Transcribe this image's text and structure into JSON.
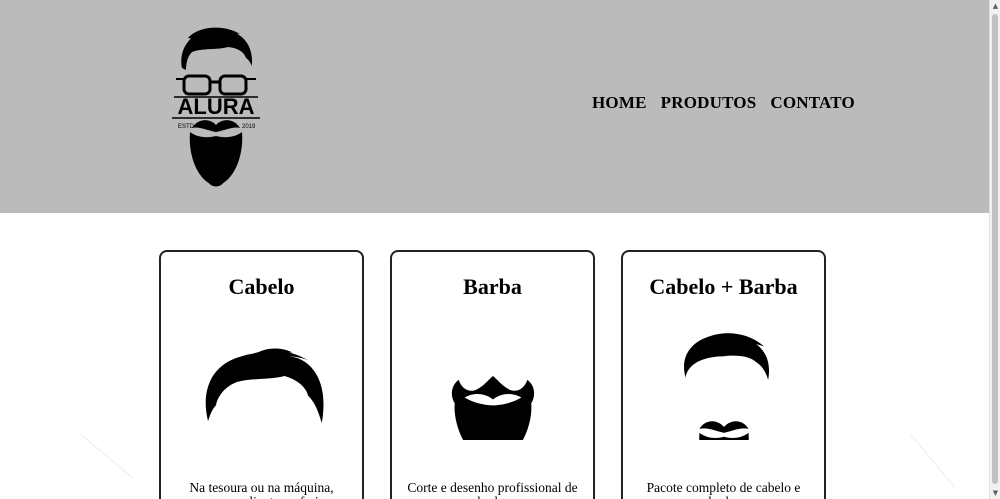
{
  "logo": {
    "brand": "ALURA",
    "left_text": "ESTD",
    "right_text": "2019"
  },
  "nav": {
    "items": [
      {
        "label": "HOME"
      },
      {
        "label": "PRODUTOS"
      },
      {
        "label": "CONTATO"
      }
    ]
  },
  "products": [
    {
      "title": "Cabelo",
      "description": "Na tesoura ou na máquina, como o cliente preferir",
      "icon": "hair-icon"
    },
    {
      "title": "Barba",
      "description": "Corte e desenho profissional de barba",
      "icon": "beard-icon"
    },
    {
      "title": "Cabelo + Barba",
      "description": "Pacote completo de cabelo e barba",
      "icon": "hair-beard-icon"
    }
  ],
  "colors": {
    "header_bg": "#bbbbbb",
    "text": "#000000",
    "card_border": "#222222"
  }
}
